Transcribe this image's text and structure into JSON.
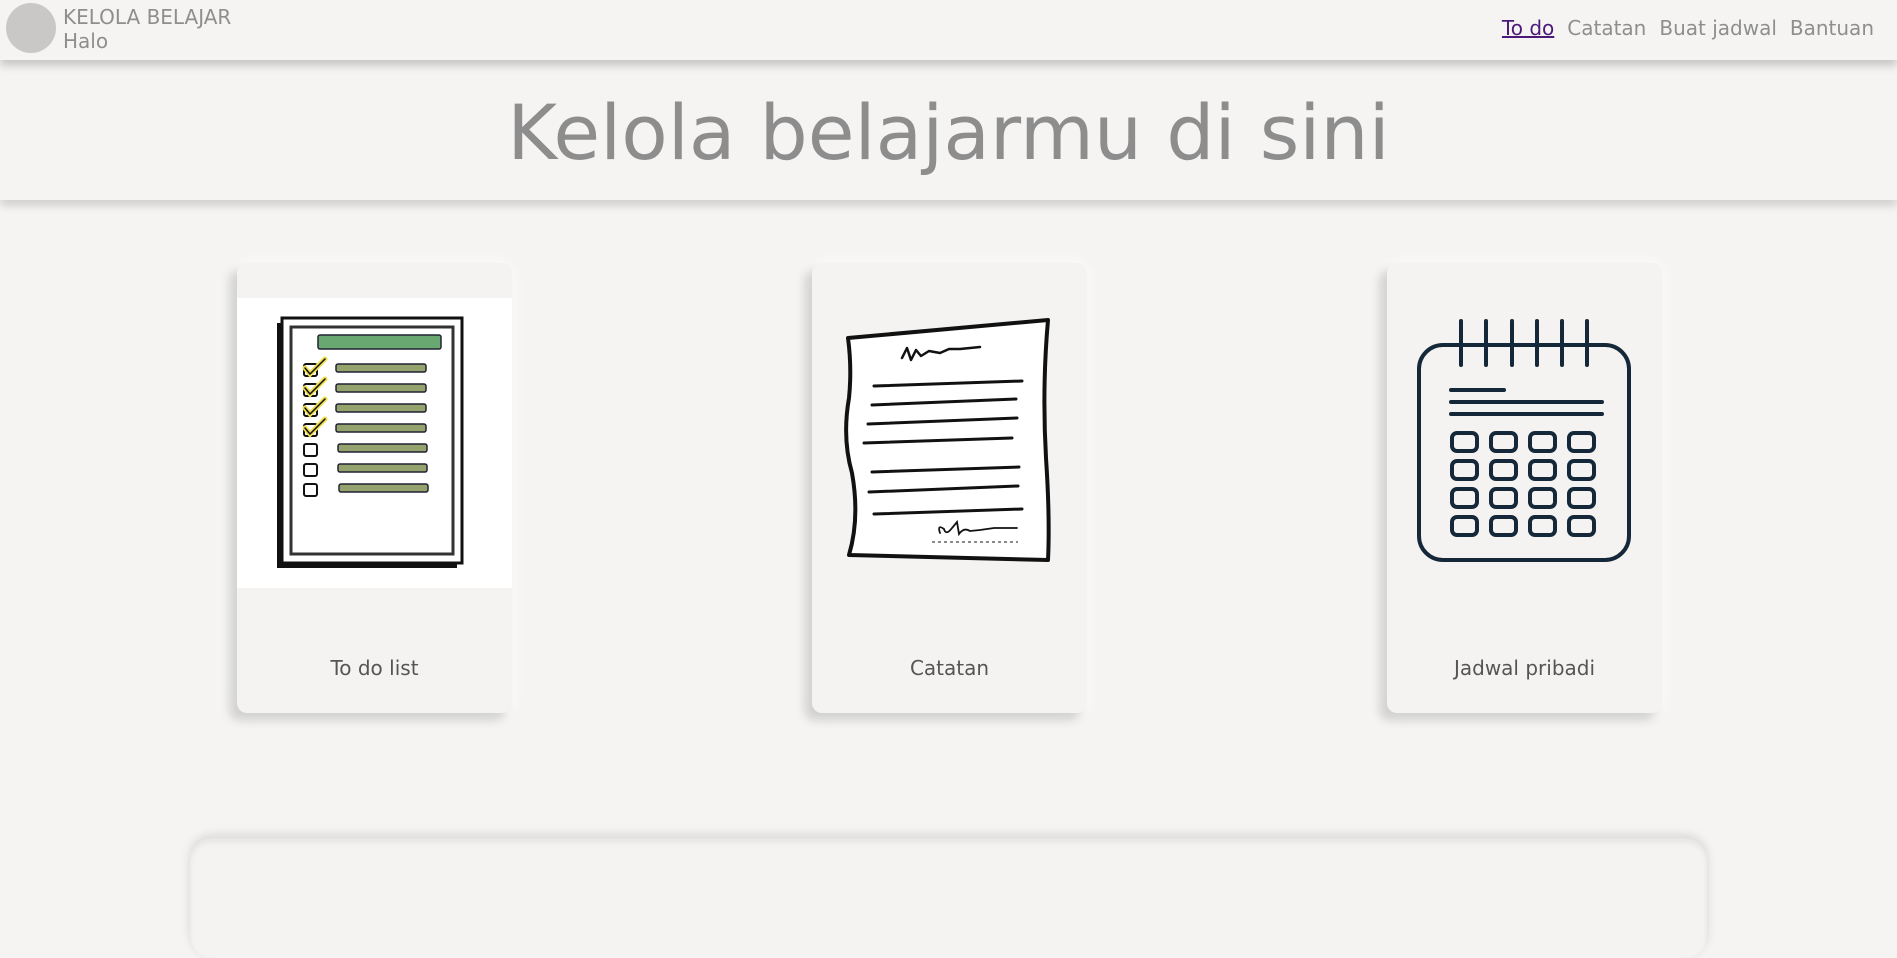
{
  "header": {
    "brand_title": "KELOLA BELAJAR",
    "brand_subtitle": "Halo",
    "nav": [
      {
        "label": "To do",
        "active": true
      },
      {
        "label": "Catatan",
        "active": false
      },
      {
        "label": "Buat jadwal",
        "active": false
      },
      {
        "label": "Bantuan",
        "active": false
      }
    ]
  },
  "hero": {
    "title": "Kelola belajarmu di sini"
  },
  "cards": [
    {
      "title": "To do list",
      "icon": "checklist-icon"
    },
    {
      "title": "Catatan",
      "icon": "note-paper-icon"
    },
    {
      "title": "Jadwal pribadi",
      "icon": "calendar-icon"
    }
  ],
  "colors": {
    "background": "#f5f4f2",
    "text_muted": "#8e8e8e",
    "nav_active": "#4b1a79",
    "card_title": "#555555",
    "checklist_header": "#6aa872",
    "checklist_bars": "#94a36d",
    "calendar_stroke": "#15283a"
  }
}
